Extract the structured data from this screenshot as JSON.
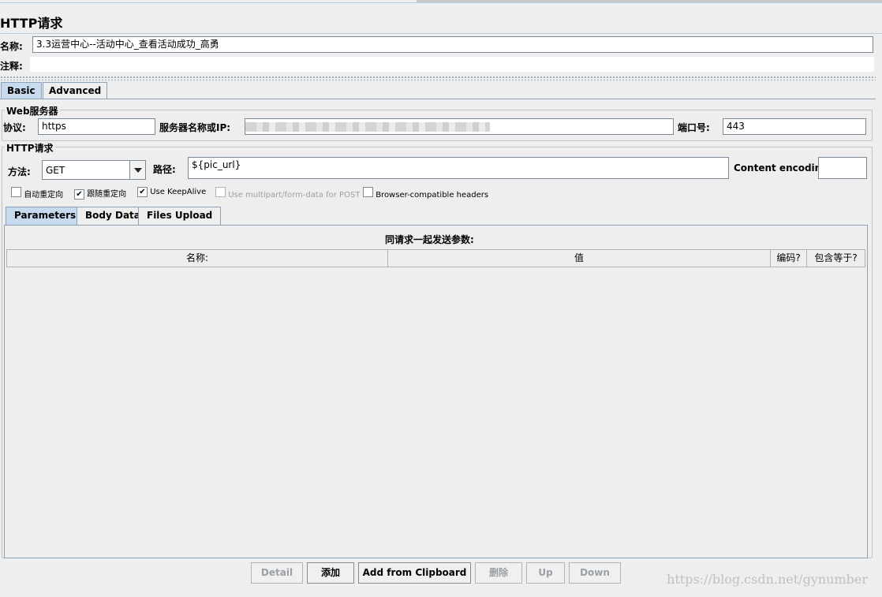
{
  "title": "HTTP请求",
  "name_label": "名称:",
  "name_value": "3.3运营中心--活动中心_查看活动成功_高勇",
  "comment_label": "注释:",
  "tabs": [
    {
      "label": "Basic"
    },
    {
      "label": "Advanced"
    }
  ],
  "web_server": {
    "group_title": "Web服务器",
    "protocol_label": "协议:",
    "protocol_value": "https",
    "server_label": "服务器名称或IP:",
    "port_label": "端口号:",
    "port_value": "443"
  },
  "http_request": {
    "group_title": "HTTP请求",
    "method_label": "方法:",
    "method_value": "GET",
    "path_label": "路径:",
    "path_value": "${pic_url}",
    "encoding_label": "Content encoding:",
    "encoding_value": ""
  },
  "checkboxes": [
    {
      "label": "自动重定向",
      "checked": false,
      "enabled": true
    },
    {
      "label": "跟随重定向",
      "checked": true,
      "enabled": true
    },
    {
      "label": "Use KeepAlive",
      "checked": true,
      "enabled": true
    },
    {
      "label": "Use multipart/form-data for POST",
      "checked": false,
      "enabled": false
    },
    {
      "label": "Browser-compatible headers",
      "checked": false,
      "enabled": true
    }
  ],
  "subtabs": [
    {
      "label": "Parameters"
    },
    {
      "label": "Body Data"
    },
    {
      "label": "Files Upload"
    }
  ],
  "params": {
    "heading": "同请求一起发送参数:",
    "columns": [
      "名称:",
      "值",
      "编码?",
      "包含等于?"
    ]
  },
  "buttons": {
    "detail": "Detail",
    "add": "添加",
    "add_clipboard": "Add from Clipboard",
    "delete": "删除",
    "up": "Up",
    "down": "Down"
  },
  "watermark": "https://blog.csdn.net/gynumber"
}
